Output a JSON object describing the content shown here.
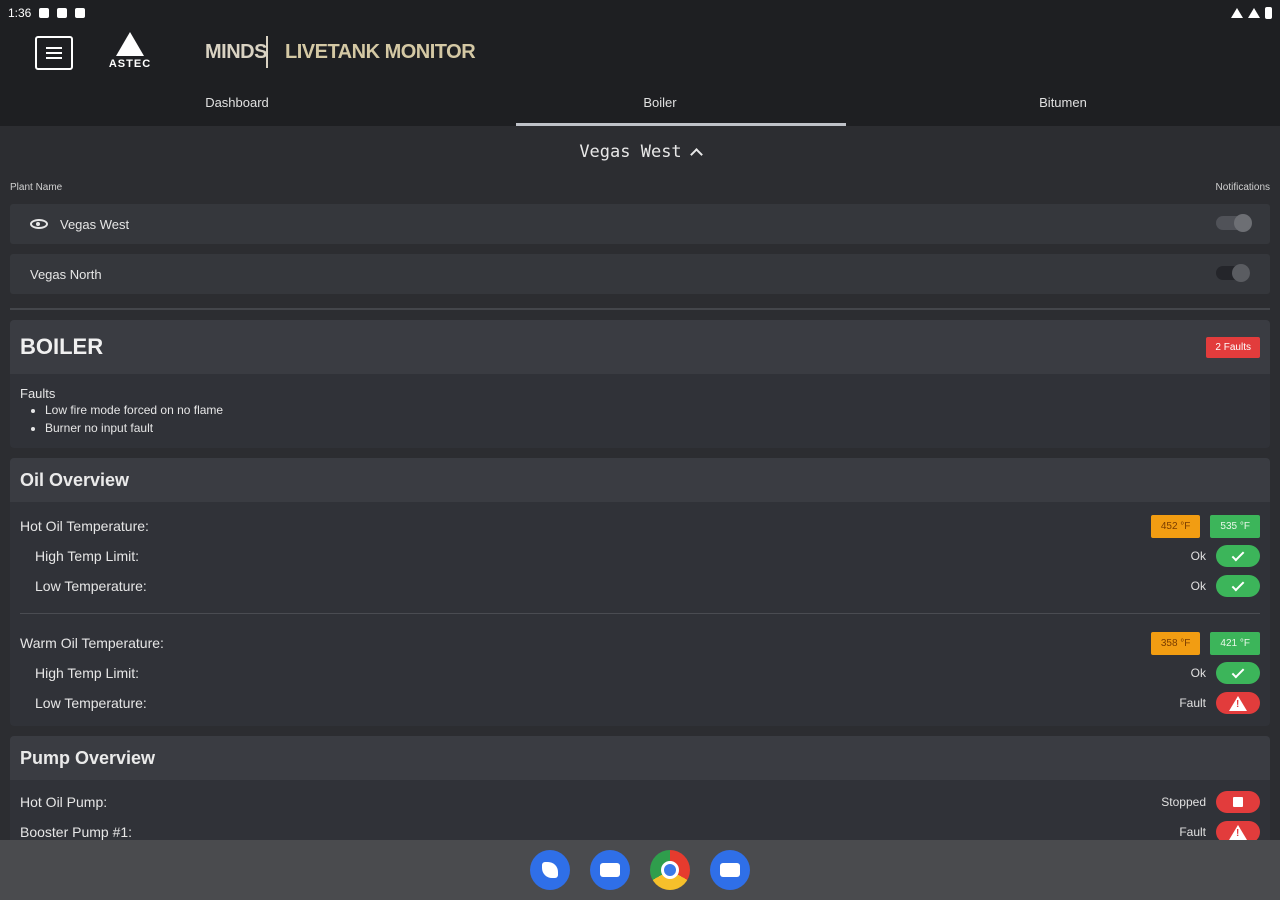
{
  "status_bar": {
    "time": "1:36"
  },
  "header": {
    "brand": "ASTEC",
    "title_part1": "MINDS",
    "title_part2": "LIVETANK MONITOR"
  },
  "tabs": [
    {
      "label": "Dashboard",
      "active": false
    },
    {
      "label": "Boiler",
      "active": true
    },
    {
      "label": "Bitumen",
      "active": false
    }
  ],
  "plant_selector": {
    "selected": "Vegas West"
  },
  "plant_list": {
    "col_name_label": "Plant Name",
    "col_notifications_label": "Notifications",
    "plants": [
      {
        "name": "Vegas West",
        "viewing": true,
        "notifications": false
      },
      {
        "name": "Vegas North",
        "viewing": false,
        "notifications": false
      }
    ]
  },
  "boiler": {
    "title": "BOILER",
    "fault_badge": "2 Faults",
    "faults_label": "Faults",
    "faults": [
      "Low fire mode forced on no flame",
      "Burner no input fault"
    ]
  },
  "oil_overview": {
    "title": "Oil Overview",
    "hot_oil": {
      "label": "Hot Oil Temperature:",
      "temp_current": "452 °F",
      "temp_setpoint": "535 °F",
      "high_temp_limit": {
        "label": "High Temp Limit:",
        "status": "Ok"
      },
      "low_temperature": {
        "label": "Low Temperature:",
        "status": "Ok"
      }
    },
    "warm_oil": {
      "label": "Warm Oil Temperature:",
      "temp_current": "358 °F",
      "temp_setpoint": "421 °F",
      "high_temp_limit": {
        "label": "High Temp Limit:",
        "status": "Ok"
      },
      "low_temperature": {
        "label": "Low Temperature:",
        "status": "Fault"
      }
    }
  },
  "pump_overview": {
    "title": "Pump Overview",
    "pumps": [
      {
        "label": "Hot Oil Pump:",
        "status": "Stopped"
      },
      {
        "label": "Booster Pump #1:",
        "status": "Fault"
      }
    ]
  },
  "colors": {
    "ok": "#3cb55a",
    "fault": "#e23c3c",
    "warning": "#f29d12",
    "header_bg": "#1e1f22",
    "title_accent": "#d4c8a4"
  },
  "navbar": {
    "apps": [
      "phone-icon",
      "messages-icon",
      "chrome-icon",
      "camera-icon"
    ]
  }
}
